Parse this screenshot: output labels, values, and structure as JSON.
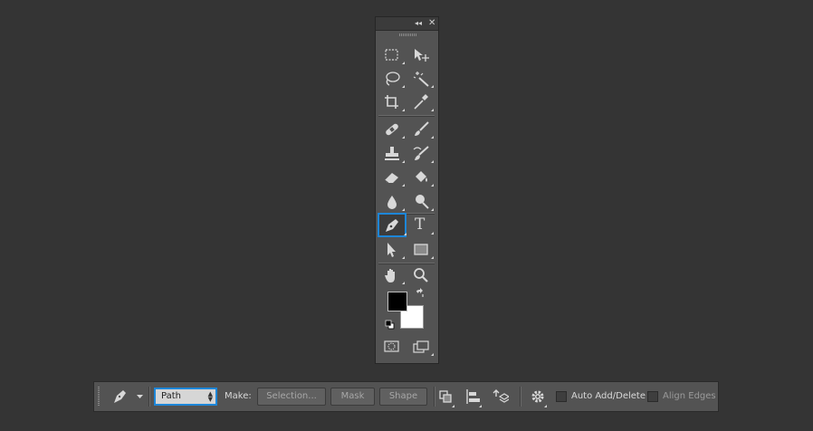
{
  "tools_panel": {
    "collapse_glyph": "◂◂",
    "close_glyph": "✕",
    "tools": [
      {
        "name": "rectangular-marquee-tool",
        "icon": "marquee-icon"
      },
      {
        "name": "move-tool",
        "icon": "move-icon"
      },
      {
        "name": "lasso-tool",
        "icon": "lasso-icon"
      },
      {
        "name": "magic-wand-tool",
        "icon": "magic-wand-icon"
      },
      {
        "name": "crop-tool",
        "icon": "crop-icon"
      },
      {
        "name": "eyedropper-tool",
        "icon": "eyedropper-icon"
      },
      {
        "name": "healing-brush-tool",
        "icon": "bandage-icon"
      },
      {
        "name": "brush-tool",
        "icon": "brush-icon"
      },
      {
        "name": "clone-stamp-tool",
        "icon": "stamp-icon"
      },
      {
        "name": "history-brush-tool",
        "icon": "history-brush-icon"
      },
      {
        "name": "eraser-tool",
        "icon": "eraser-icon"
      },
      {
        "name": "paint-bucket-tool",
        "icon": "bucket-icon"
      },
      {
        "name": "blur-tool",
        "icon": "drop-icon"
      },
      {
        "name": "dodge-tool",
        "icon": "dodge-icon"
      },
      {
        "name": "pen-tool",
        "icon": "pen-icon",
        "active": true
      },
      {
        "name": "type-tool",
        "icon": "type-icon",
        "glyph": "T"
      },
      {
        "name": "path-selection-tool",
        "icon": "arrow-icon"
      },
      {
        "name": "rectangle-tool",
        "icon": "rectangle-icon"
      },
      {
        "name": "hand-tool",
        "icon": "hand-icon"
      },
      {
        "name": "zoom-tool",
        "icon": "zoom-icon"
      }
    ],
    "foreground_color": "#000000",
    "background_color": "#ffffff"
  },
  "options_bar": {
    "mode_value": "Path",
    "make_label": "Make:",
    "selection_button": "Selection...",
    "mask_button": "Mask",
    "shape_button": "Shape",
    "auto_add_delete_label": "Auto Add/Delete",
    "auto_add_delete_checked": false,
    "align_edges_label": "Align Edges",
    "align_edges_checked": false
  },
  "colors": {
    "accent": "#1d86d8",
    "background": "#343434",
    "panel": "#535353"
  }
}
